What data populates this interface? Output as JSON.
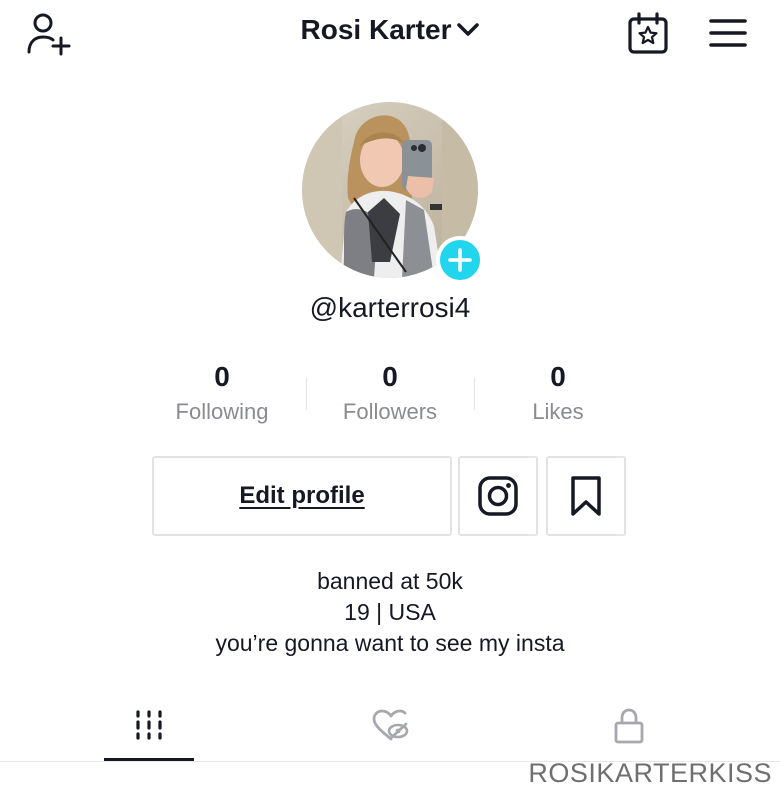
{
  "header": {
    "title": "Rosi Karter",
    "icons": [
      "add-user-icon",
      "chevron-down-icon",
      "calendar-star-icon",
      "hamburger-menu-icon"
    ]
  },
  "profile": {
    "username": "@karterrosi4",
    "avatar": "profile-photo",
    "badge_icon": "plus-icon",
    "accent_color": "#20d5ec"
  },
  "stats": [
    {
      "value": "0",
      "label": "Following"
    },
    {
      "value": "0",
      "label": "Followers"
    },
    {
      "value": "0",
      "label": "Likes"
    }
  ],
  "actions": {
    "edit_label": "Edit profile",
    "instagram_icon": "instagram-icon",
    "favorites_icon": "bookmark-icon"
  },
  "bio": {
    "line1": "banned at 50k",
    "line2": "19 | USA",
    "line3": "you’re gonna want to see my insta"
  },
  "tabs": [
    {
      "name": "videos",
      "icon": "grid-icon",
      "active": true
    },
    {
      "name": "liked",
      "icon": "liked-hidden-icon",
      "active": false
    },
    {
      "name": "private",
      "icon": "lock-icon",
      "active": false
    }
  ],
  "watermark": "ROSIKARTERKISS"
}
